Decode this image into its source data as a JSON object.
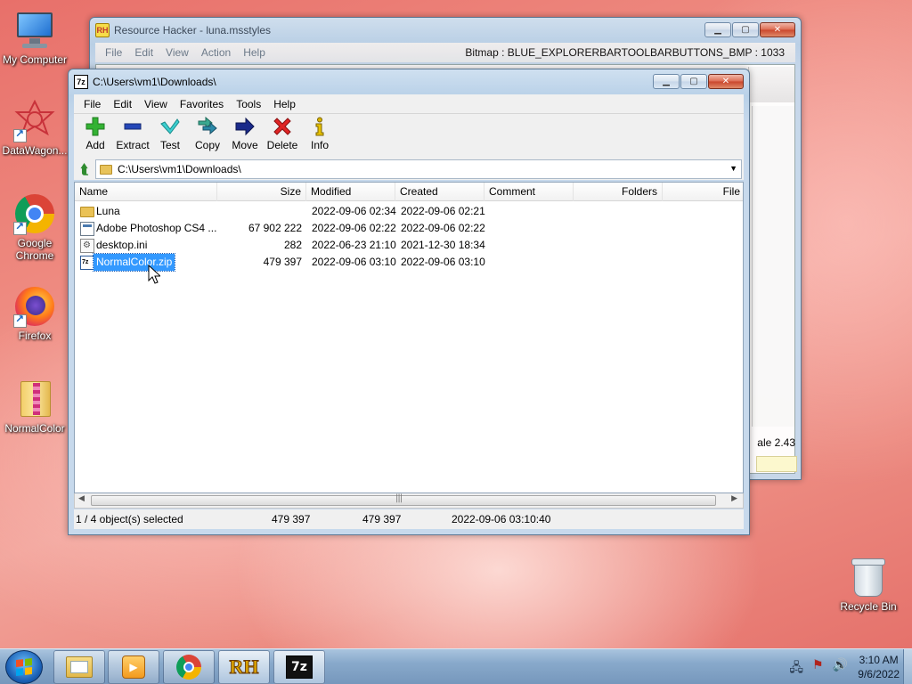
{
  "desktop": {
    "icons": [
      {
        "label": "My Computer"
      },
      {
        "label": "DataWagon..."
      },
      {
        "label": "Google Chrome"
      },
      {
        "label": "Firefox"
      },
      {
        "label": "NormalColor"
      },
      {
        "label": "Recycle Bin"
      }
    ]
  },
  "resource_hacker": {
    "title": "Resource Hacker - luna.msstyles",
    "icon_text": "RH",
    "menu": [
      "File",
      "Edit",
      "View",
      "Action",
      "Help"
    ],
    "bitmap_info": "Bitmap : BLUE_EXPLORERBARTOOLBARBUTTONS_BMP : 1033",
    "scale_text": "ale 2.43"
  },
  "sevenzip": {
    "title": "C:\\Users\\vm1\\Downloads\\",
    "icon_text": "7z",
    "menu": [
      "File",
      "Edit",
      "View",
      "Favorites",
      "Tools",
      "Help"
    ],
    "toolbar": [
      {
        "label": "Add",
        "icon": "plus-icon",
        "color": "#2aa52a"
      },
      {
        "label": "Extract",
        "icon": "minus-icon",
        "color": "#1f3fa8"
      },
      {
        "label": "Test",
        "icon": "check-icon",
        "color": "#29b8b8"
      },
      {
        "label": "Copy",
        "icon": "double-arrow-icon",
        "color": "#2a9a8a"
      },
      {
        "label": "Move",
        "icon": "arrow-right-icon",
        "color": "#1a2a8a"
      },
      {
        "label": "Delete",
        "icon": "x-icon",
        "color": "#d62020"
      },
      {
        "label": "Info",
        "icon": "info-icon",
        "color": "#c9a400"
      }
    ],
    "address": "C:\\Users\\vm1\\Downloads\\",
    "columns": [
      "Name",
      "Size",
      "Modified",
      "Created",
      "Comment",
      "Folders",
      "File"
    ],
    "files": [
      {
        "name": "Luna",
        "size": "",
        "modified": "2022-09-06 02:34",
        "created": "2022-09-06 02:21",
        "type": "folder"
      },
      {
        "name": "Adobe Photoshop CS4 ...",
        "size": "67 902 222",
        "modified": "2022-09-06 02:22",
        "created": "2022-09-06 02:22",
        "type": "exe"
      },
      {
        "name": "desktop.ini",
        "size": "282",
        "modified": "2022-06-23 21:10",
        "created": "2021-12-30 18:34",
        "type": "ini"
      },
      {
        "name": "NormalColor.zip",
        "size": "479 397",
        "modified": "2022-09-06 03:10",
        "created": "2022-09-06 03:10",
        "type": "zip",
        "selected": true
      }
    ],
    "status": {
      "selection": "1 / 4 object(s) selected",
      "size": "479 397",
      "packed": "479 397",
      "date": "2022-09-06 03:10:40"
    }
  },
  "taskbar": {
    "time": "3:10 AM",
    "date": "9/6/2022",
    "rh_label": "RH",
    "zip_label": "7z"
  }
}
